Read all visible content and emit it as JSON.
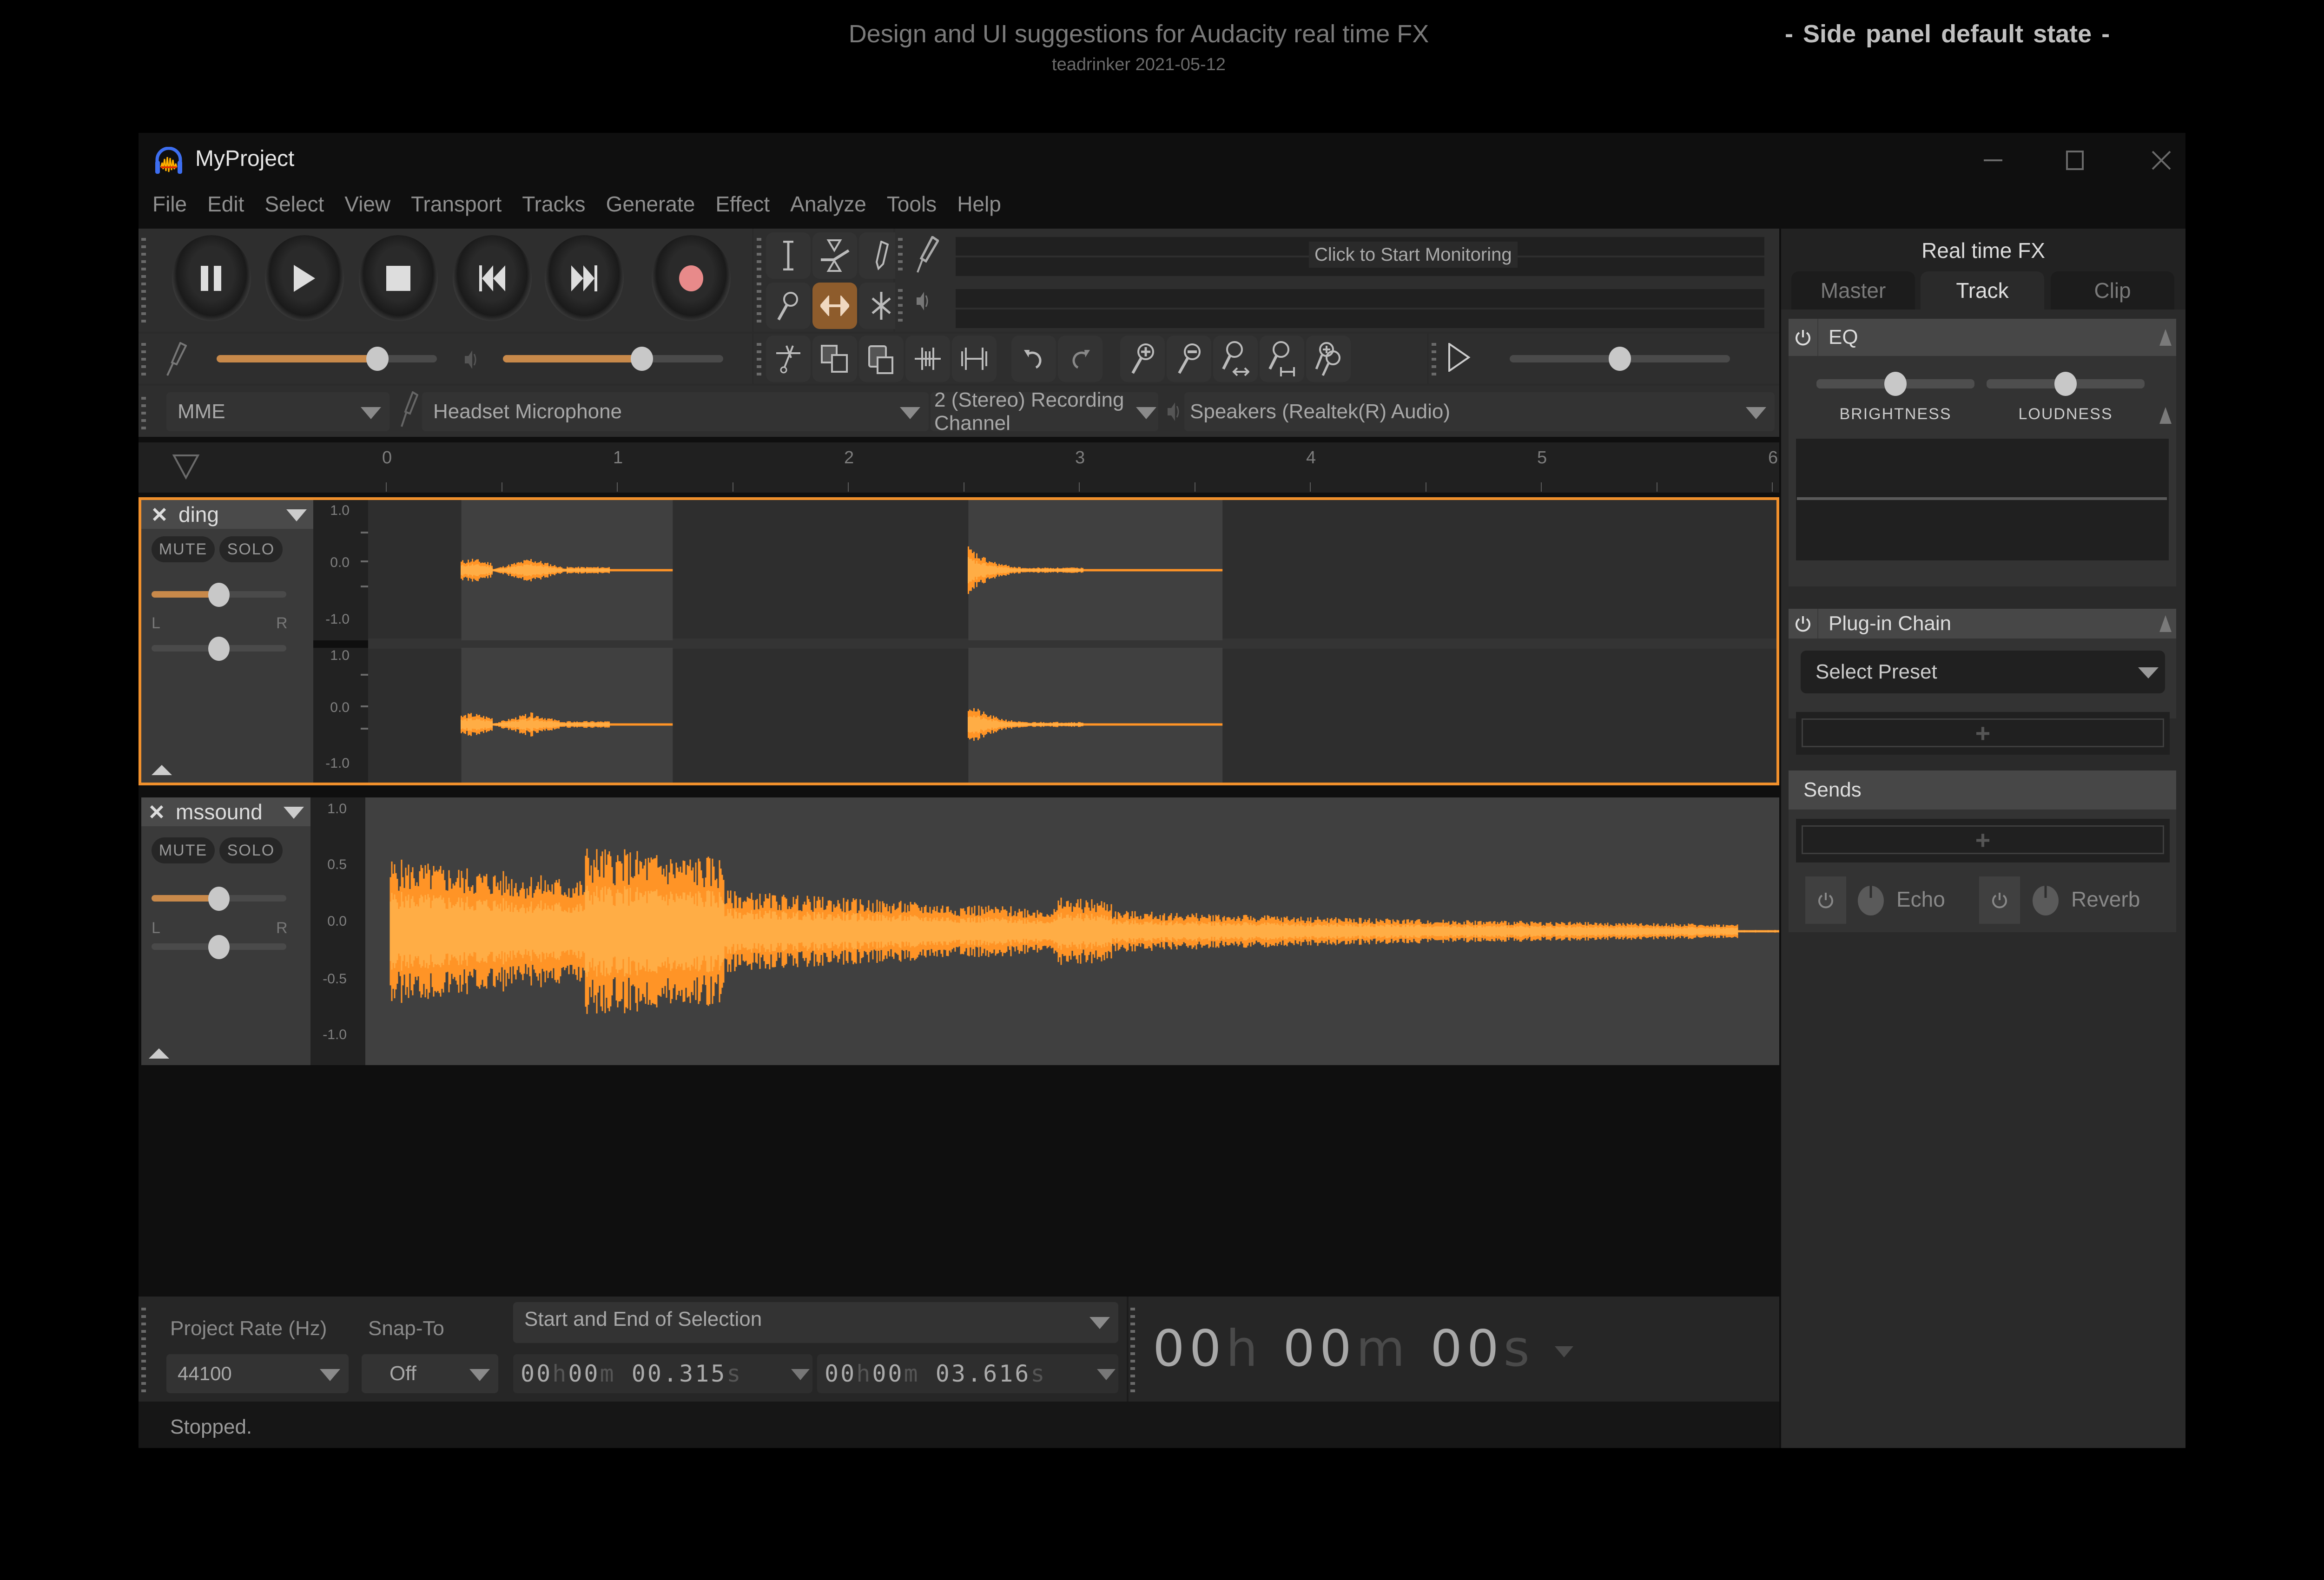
{
  "document": {
    "title": "Design and UI suggestions for Audacity real time FX",
    "subtitle": "teadrinker 2021-05-12",
    "state_label": "-   Side panel default state   -"
  },
  "window": {
    "title": "MyProject",
    "controls": {
      "minimize": "minimize-icon",
      "maximize": "maximize-icon",
      "close": "close-icon"
    }
  },
  "menu": [
    "File",
    "Edit",
    "Select",
    "View",
    "Transport",
    "Tracks",
    "Generate",
    "Effect",
    "Analyze",
    "Tools",
    "Help"
  ],
  "transport": {
    "buttons": [
      {
        "name": "pause",
        "icon": "pause-icon"
      },
      {
        "name": "play",
        "icon": "play-icon"
      },
      {
        "name": "stop",
        "icon": "stop-icon"
      },
      {
        "name": "skip-start",
        "icon": "skip-start-icon"
      },
      {
        "name": "skip-end",
        "icon": "skip-end-icon"
      },
      {
        "name": "record",
        "icon": "record-icon"
      }
    ],
    "record_color": "#e88a8a"
  },
  "tools": {
    "items": [
      "selection-tool",
      "envelope-tool",
      "draw-tool",
      "zoom-tool",
      "time-shift-tool",
      "multi-tool"
    ],
    "active": "time-shift-tool",
    "accent": "#8e5c2c"
  },
  "meters": {
    "record_hint": "Click to Start Monitoring"
  },
  "mixer": {
    "recording_volume": 0.73,
    "playback_volume": 0.63
  },
  "edit_toolbar": [
    "cut-icon",
    "copy-icon",
    "paste-icon",
    "trim-icon",
    "silence-icon",
    "undo-icon",
    "redo-icon",
    "zoom-in-icon",
    "zoom-out-icon",
    "fit-selection-icon",
    "fit-project-icon",
    "zoom-toggle-icon"
  ],
  "play_at_speed": {
    "speed": 0.5
  },
  "devices": {
    "host": "MME",
    "input": "Headset Microphone",
    "channels": "2 (Stereo) Recording Channel",
    "output": "Speakers (Realtek(R) Audio)"
  },
  "ruler": {
    "ticks": [
      "0",
      "1",
      "2",
      "3",
      "4",
      "5",
      "6"
    ]
  },
  "tracks": [
    {
      "name": "ding",
      "selected": true,
      "mute": "MUTE",
      "solo": "SOLO",
      "gain": 0.5,
      "pan_left": "L",
      "pan_right": "R",
      "pan": 0.5,
      "channels": [
        {
          "scale": [
            "1.0",
            "0.0",
            "-1.0"
          ]
        },
        {
          "scale": [
            "1.0",
            "0.0",
            "-1.0"
          ]
        }
      ],
      "clips": [
        {
          "start": 0.315,
          "end": 1.23
        },
        {
          "start": 2.51,
          "end": 3.61
        }
      ]
    },
    {
      "name": "mssound",
      "selected": false,
      "mute": "MUTE",
      "solo": "SOLO",
      "gain": 0.5,
      "pan_left": "L",
      "pan_right": "R",
      "pan": 0.5,
      "channels": [
        {
          "scale": [
            "1.0",
            "0.5",
            "0.0",
            "-0.5",
            "-1.0"
          ]
        }
      ]
    }
  ],
  "selection": {
    "project_rate_label": "Project Rate (Hz)",
    "project_rate": "44100",
    "snap_label": "Snap-To",
    "snap": "Off",
    "format": "Start and End of Selection",
    "start": {
      "h": "00",
      "m": "00",
      "s": "00.315"
    },
    "end": {
      "h": "00",
      "m": "00",
      "s": "03.616"
    },
    "units": {
      "h": "h",
      "m": "m",
      "s": "s"
    }
  },
  "audio_position": {
    "h": "00",
    "m": "00",
    "s": "00"
  },
  "status": "Stopped.",
  "side_panel": {
    "title": "Real time FX",
    "tabs": [
      "Master",
      "Track",
      "Clip"
    ],
    "active_tab": "Track",
    "eq": {
      "title": "EQ",
      "brightness_label": "BRIGHTNESS",
      "brightness": 0.5,
      "loudness_label": "LOUDNESS",
      "loudness": 0.5
    },
    "plugin_chain": {
      "title": "Plug-in Chain",
      "preset_placeholder": "Select Preset",
      "add_label": "+"
    },
    "sends": {
      "title": "Sends",
      "add_label": "+",
      "items": [
        {
          "name": "Echo"
        },
        {
          "name": "Reverb"
        }
      ]
    }
  },
  "colors": {
    "accent": "#f0902c",
    "waveform": "#ffad45",
    "waveform_dark": "#ff9426"
  }
}
